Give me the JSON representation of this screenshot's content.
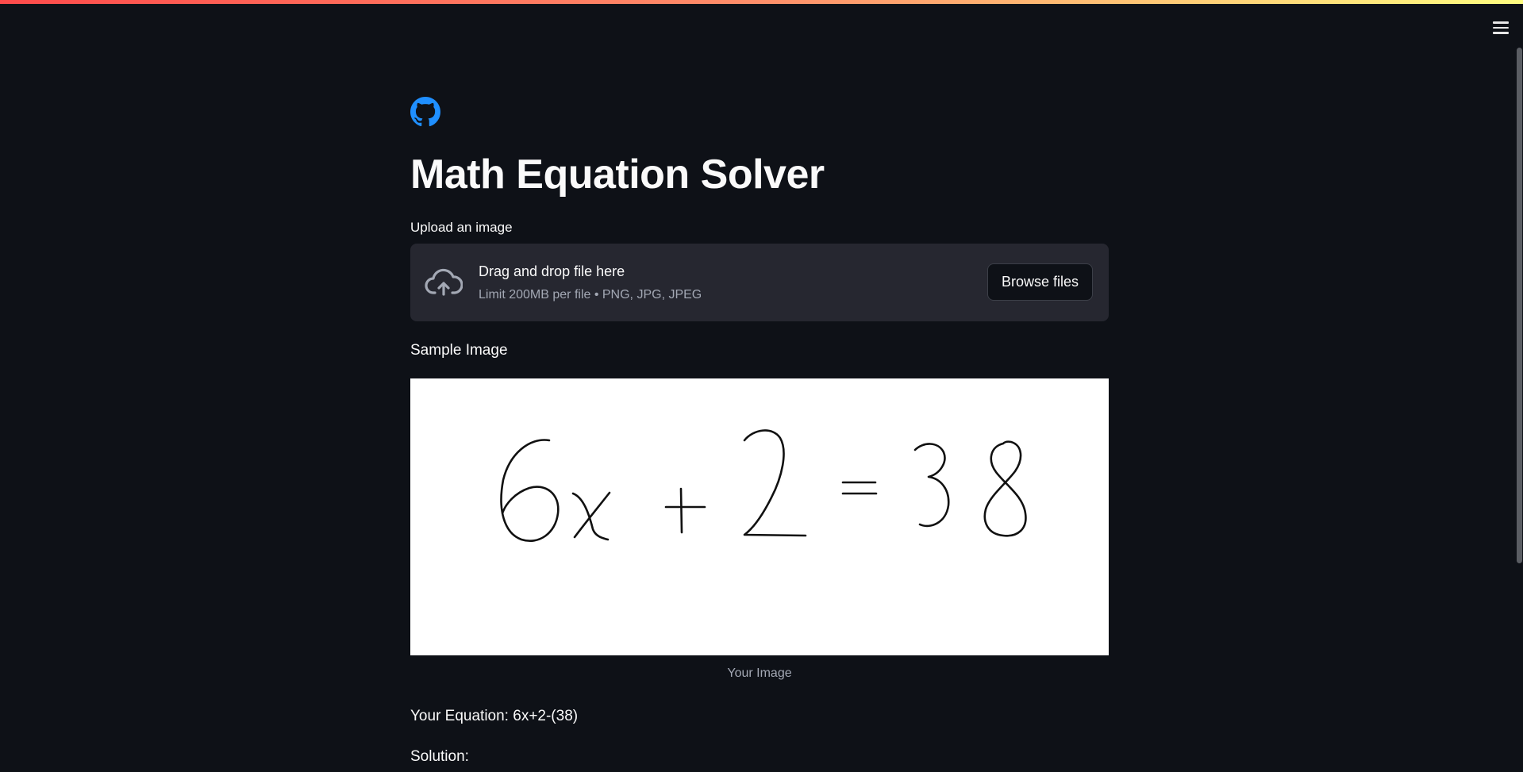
{
  "header": {
    "menu_icon": "hamburger-menu-icon",
    "github_icon": "github-icon"
  },
  "main": {
    "title": "Math Equation Solver",
    "uploader": {
      "label": "Upload an image",
      "instruction": "Drag and drop file here",
      "limit": "Limit 200MB per file • PNG, JPG, JPEG",
      "browse_label": "Browse files",
      "upload_icon": "cloud-upload-icon"
    },
    "sample": {
      "label": "Sample Image",
      "image_content": "6x + 2 = 38",
      "caption": "Your Image"
    },
    "equation": {
      "label": "Your Equation:",
      "value": "6x+2-(38)"
    },
    "solution": {
      "label": "Solution:"
    }
  },
  "colors": {
    "background": "#0e1117",
    "text": "#fafafa",
    "muted_text": "#a3a8b4",
    "dropzone": "#262730",
    "github_blue": "#1f8fff"
  }
}
